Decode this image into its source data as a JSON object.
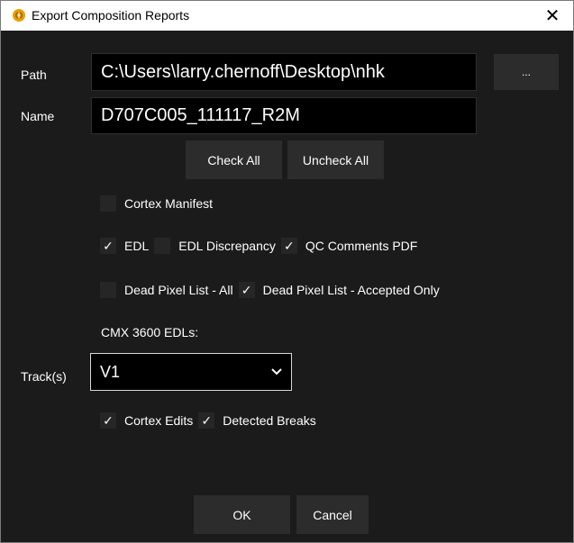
{
  "window": {
    "title": "Export Composition Reports",
    "close_glyph": "✕",
    "accent_color": "#e8a000"
  },
  "path": {
    "label": "Path",
    "value": "C:\\Users\\larry.chernoff\\Desktop\\nhk",
    "browse_label": "..."
  },
  "name": {
    "label": "Name",
    "value": "D707C005_111117_R2M"
  },
  "bulk": {
    "check_all": "Check All",
    "uncheck_all": "Uncheck All"
  },
  "reports": {
    "cortex_manifest": {
      "label": "Cortex Manifest",
      "checked": false
    },
    "edl": {
      "label": "EDL",
      "checked": true
    },
    "edl_discrepancy": {
      "label": "EDL Discrepancy",
      "checked": false
    },
    "qc_comments_pdf": {
      "label": "QC Comments PDF",
      "checked": true
    },
    "dead_pixel_all": {
      "label": "Dead Pixel List - All",
      "checked": false
    },
    "dead_pixel_accepted": {
      "label": "Dead Pixel List - Accepted Only",
      "checked": true
    }
  },
  "cmx": {
    "header": "CMX 3600 EDLs:",
    "track_label": "Track(s)",
    "track_value": "V1",
    "cortex_edits": {
      "label": "Cortex Edits",
      "checked": true
    },
    "detected_breaks": {
      "label": "Detected Breaks",
      "checked": true
    }
  },
  "footer": {
    "ok": "OK",
    "cancel": "Cancel"
  },
  "check_glyph": "✓"
}
